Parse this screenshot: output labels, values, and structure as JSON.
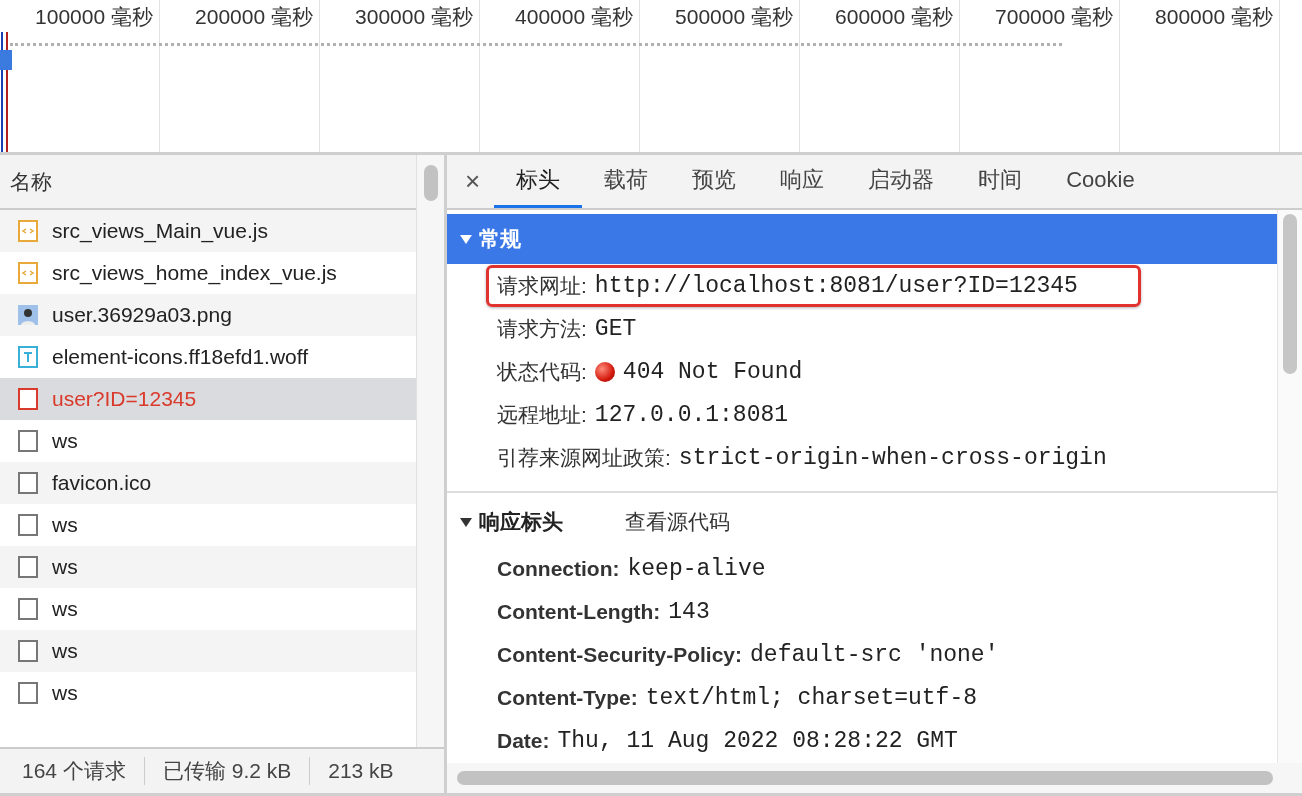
{
  "timeline": {
    "ticks": [
      "100000 毫秒",
      "200000 毫秒",
      "300000 毫秒",
      "400000 毫秒",
      "500000 毫秒",
      "600000 毫秒",
      "700000 毫秒",
      "800000 毫秒"
    ]
  },
  "request_list": {
    "column": "名称",
    "rows": [
      {
        "name": "src_views_Main_vue.js",
        "kind": "script",
        "selected": false,
        "failed": false
      },
      {
        "name": "src_views_home_index_vue.js",
        "kind": "script",
        "selected": false,
        "failed": false
      },
      {
        "name": "user.36929a03.png",
        "kind": "image",
        "selected": false,
        "failed": false
      },
      {
        "name": "element-icons.ff18efd1.woff",
        "kind": "font",
        "selected": false,
        "failed": false
      },
      {
        "name": "user?ID=12345",
        "kind": "document",
        "selected": true,
        "failed": true
      },
      {
        "name": "ws",
        "kind": "document",
        "selected": false,
        "failed": false
      },
      {
        "name": "favicon.ico",
        "kind": "document",
        "selected": false,
        "failed": false
      },
      {
        "name": "ws",
        "kind": "document",
        "selected": false,
        "failed": false
      },
      {
        "name": "ws",
        "kind": "document",
        "selected": false,
        "failed": false
      },
      {
        "name": "ws",
        "kind": "document",
        "selected": false,
        "failed": false
      },
      {
        "name": "ws",
        "kind": "document",
        "selected": false,
        "failed": false
      },
      {
        "name": "ws",
        "kind": "document",
        "selected": false,
        "failed": false
      }
    ]
  },
  "status_bar": [
    "164 个请求",
    "已传输 9.2 kB",
    "213 kB"
  ],
  "details": {
    "close": "×",
    "tabs": [
      {
        "label": "标头",
        "selected": true
      },
      {
        "label": "载荷",
        "selected": false
      },
      {
        "label": "预览",
        "selected": false
      },
      {
        "label": "响应",
        "selected": false
      },
      {
        "label": "启动器",
        "selected": false
      },
      {
        "label": "时间",
        "selected": false
      },
      {
        "label": "Cookie",
        "selected": false
      }
    ],
    "general": {
      "title": "常规",
      "expanded": true,
      "rows": [
        {
          "label": "请求网址:",
          "value": "http://localhost:8081/user?ID=12345",
          "highlighted": true,
          "status_dot": false
        },
        {
          "label": "请求方法:",
          "value": "GET",
          "highlighted": false,
          "status_dot": false
        },
        {
          "label": "状态代码:",
          "value": "404 Not Found",
          "highlighted": false,
          "status_dot": true
        },
        {
          "label": "远程地址:",
          "value": "127.0.0.1:8081",
          "highlighted": false,
          "status_dot": false
        },
        {
          "label": "引荐来源网址政策:",
          "value": "strict-origin-when-cross-origin",
          "highlighted": false,
          "status_dot": false
        }
      ]
    },
    "response_headers": {
      "title": "响应标头",
      "expanded": true,
      "view_source": "查看源代码",
      "rows": [
        {
          "label": "Connection:",
          "value": "keep-alive"
        },
        {
          "label": "Content-Length:",
          "value": "143"
        },
        {
          "label": "Content-Security-Policy:",
          "value": "default-src 'none'"
        },
        {
          "label": "Content-Type:",
          "value": "text/html; charset=utf-8"
        },
        {
          "label": "Date:",
          "value": "Thu, 11 Aug 2022 08:28:22 GMT"
        }
      ]
    }
  }
}
